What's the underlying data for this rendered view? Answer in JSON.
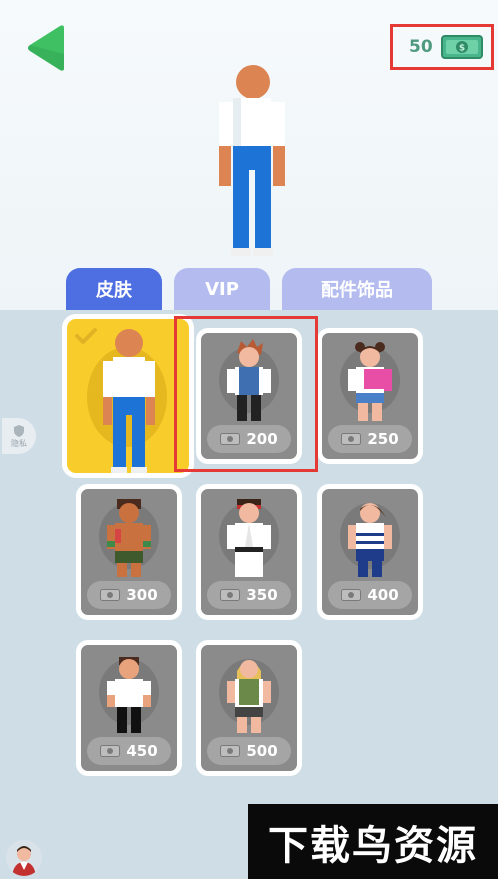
{
  "header": {
    "back_icon": "back-arrow-icon",
    "currency": {
      "amount": "50",
      "icon": "cash-icon"
    }
  },
  "tabs": [
    {
      "label": "皮肤",
      "active": true
    },
    {
      "label": "VIP",
      "active": false
    },
    {
      "label": "配件饰品",
      "active": false
    }
  ],
  "privacy": {
    "label": "隐私",
    "icon": "shield-icon"
  },
  "skins": [
    {
      "id": "default",
      "price": "",
      "selected": true,
      "owned": true
    },
    {
      "id": "spiky-hair",
      "price": "200"
    },
    {
      "id": "pink-girl",
      "price": "250"
    },
    {
      "id": "fighter",
      "price": "300"
    },
    {
      "id": "karate",
      "price": "350"
    },
    {
      "id": "boxer-girl",
      "price": "400"
    },
    {
      "id": "casual",
      "price": "450"
    },
    {
      "id": "vest-girl",
      "price": "500"
    }
  ],
  "watermark": {
    "text": "下载鸟资源"
  },
  "colors": {
    "accent": "#4d6fe2",
    "tab_inactive": "#b4bbef",
    "selected_card": "#f8cc2a",
    "highlight": "#e53935",
    "back_arrow": "#3fc163",
    "currency_text": "#4e9a7e"
  }
}
